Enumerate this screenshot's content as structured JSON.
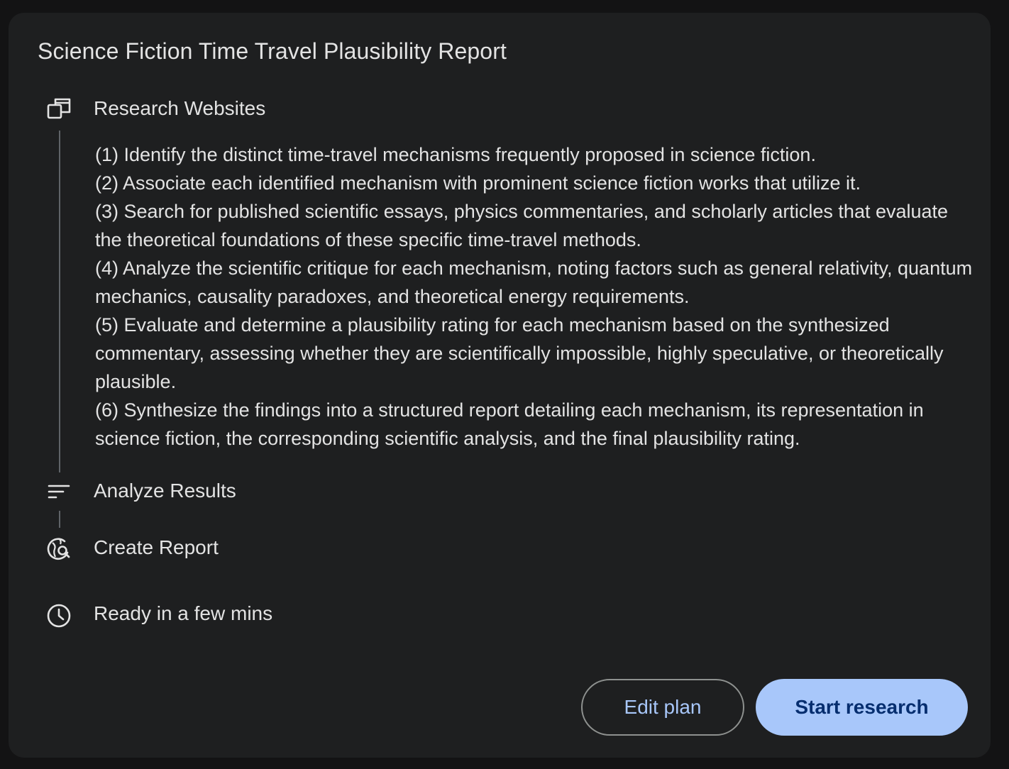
{
  "plan": {
    "title": "Science Fiction Time Travel Plausibility Report",
    "steps": [
      {
        "icon": "browser-windows-icon",
        "label": "Research Websites"
      },
      {
        "icon": "sort-lines-icon",
        "label": "Analyze Results"
      },
      {
        "icon": "globe-search-icon",
        "label": "Create Report"
      }
    ],
    "research_items": [
      "(1) Identify the distinct time-travel mechanisms frequently proposed in science fiction.",
      "(2) Associate each identified mechanism with prominent science fiction works that utilize it.",
      "(3) Search for published scientific essays, physics commentaries, and scholarly articles that evaluate the theoretical foundations of these specific time-travel methods.",
      "(4) Analyze the scientific critique for each mechanism, noting factors such as general relativity, quantum mechanics, causality paradoxes, and theoretical energy requirements.",
      "(5) Evaluate and determine a plausibility rating for each mechanism based on the synthesized commentary, assessing whether they are scientifically impossible, highly speculative, or theoretically plausible.",
      "(6) Synthesize the findings into a structured report detailing each mechanism, its representation in science fiction, the corresponding scientific analysis, and the final plausibility rating."
    ],
    "eta": {
      "icon": "clock-icon",
      "label": "Ready in a few mins"
    }
  },
  "actions": {
    "edit_label": "Edit plan",
    "start_label": "Start research"
  },
  "colors": {
    "page_background": "#131314",
    "card_background": "#1e1f20",
    "text": "#e3e3e3",
    "accent": "#a8c7fa",
    "accent_text": "#062e6f"
  }
}
